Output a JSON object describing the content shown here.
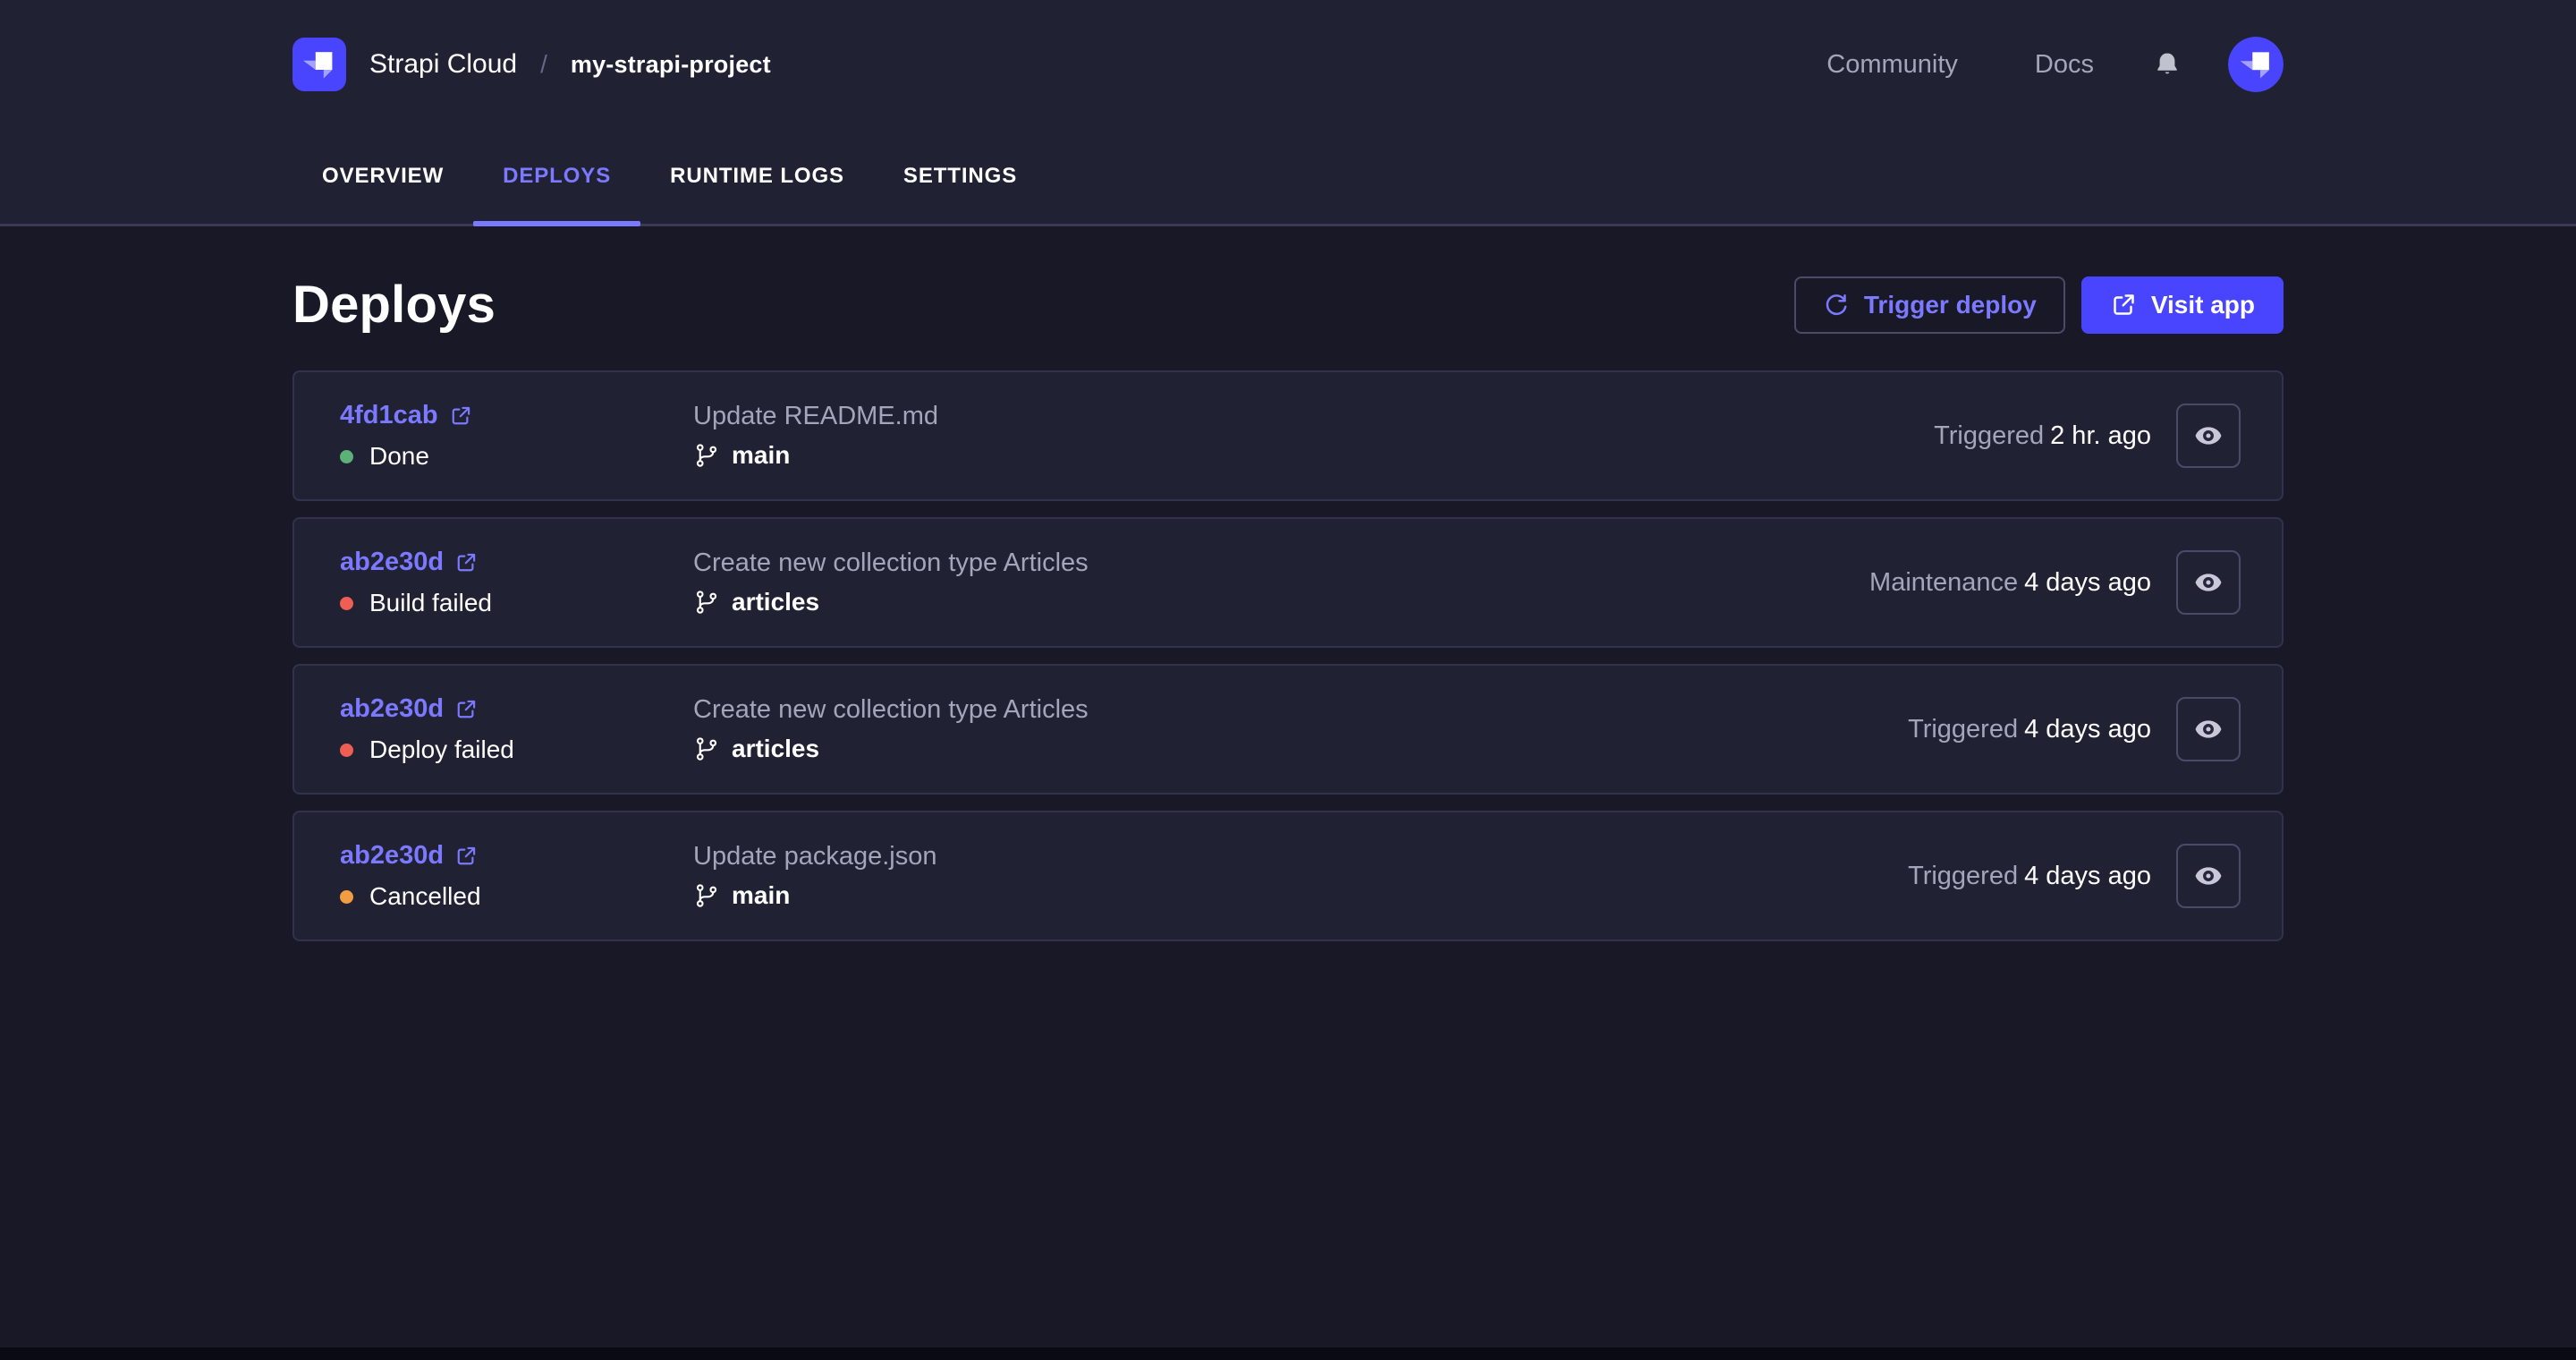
{
  "header": {
    "brand": "Strapi Cloud",
    "breadcrumb_separator": "/",
    "project_name": "my-strapi-project",
    "community_label": "Community",
    "docs_label": "Docs"
  },
  "tabs": [
    {
      "label": "OVERVIEW",
      "name": "tab-overview",
      "active": false
    },
    {
      "label": "DEPLOYS",
      "name": "tab-deploys",
      "active": true
    },
    {
      "label": "RUNTIME LOGS",
      "name": "tab-runtime-logs",
      "active": false
    },
    {
      "label": "SETTINGS",
      "name": "tab-settings",
      "active": false
    }
  ],
  "page": {
    "title": "Deploys",
    "trigger_deploy_label": "Trigger deploy",
    "visit_app_label": "Visit app"
  },
  "deploys": [
    {
      "hash": "4fd1cab",
      "status": "Done",
      "status_color": "#5cb176",
      "message": "Update README.md",
      "branch": "main",
      "trigger_label": "Triggered",
      "time": "2 hr. ago"
    },
    {
      "hash": "ab2e30d",
      "status": "Build failed",
      "status_color": "#ee5e52",
      "message": "Create new collection type Articles",
      "branch": "articles",
      "trigger_label": "Maintenance",
      "time": "4 days ago"
    },
    {
      "hash": "ab2e30d",
      "status": "Deploy failed",
      "status_color": "#ee5e52",
      "message": "Create new collection type Articles",
      "branch": "articles",
      "trigger_label": "Triggered",
      "time": "4 days ago"
    },
    {
      "hash": "ab2e30d",
      "status": "Cancelled",
      "status_color": "#f29d41",
      "message": "Update package.json",
      "branch": "main",
      "trigger_label": "Triggered",
      "time": "4 days ago"
    }
  ],
  "icons": {
    "logo": "strapi-logo",
    "avatar": "strapi-avatar",
    "notifications": "bell-icon",
    "trigger_deploy": "refresh-icon",
    "visit_app": "external-link-icon",
    "commit_link": "external-link-icon",
    "branch": "git-branch-icon",
    "view_deploy": "eye-icon"
  },
  "colors": {
    "brand_accent": "#4945ff",
    "link_purple": "#7b79ff",
    "success": "#5cb176",
    "danger": "#ee5e52",
    "warning": "#f29d41",
    "header_bg": "#212134",
    "page_bg": "#181826",
    "card_bg": "#212134",
    "card_border": "#32324d"
  }
}
